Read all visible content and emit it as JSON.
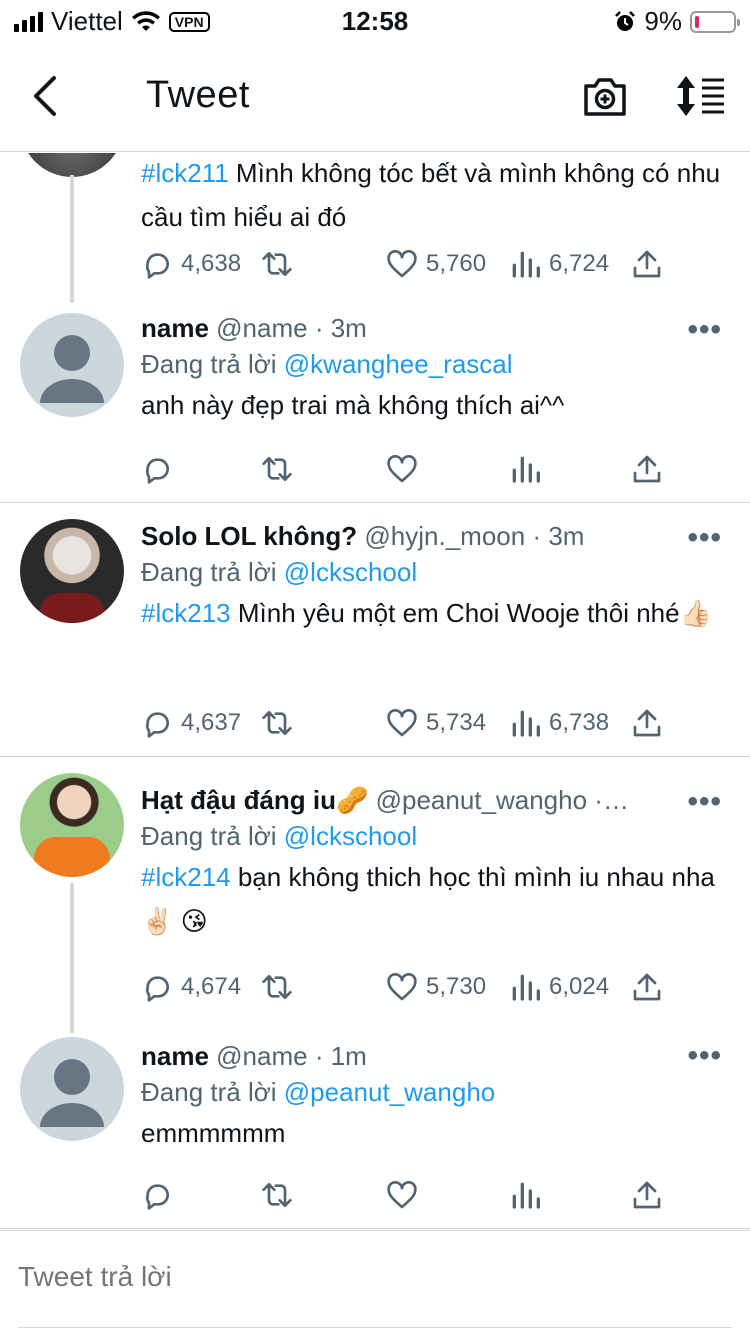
{
  "status_bar": {
    "carrier": "Viettel",
    "vpn": "VPN",
    "time": "12:58",
    "battery": "9%"
  },
  "nav": {
    "title": "Tweet"
  },
  "tweets": [
    {
      "body_tag": "#lck211",
      "body_text": " Mình không tóc bết và mình không có nhu cầu tìm hiểu ai đó",
      "replies": "4,638",
      "likes": "5,760",
      "views": "6,724"
    },
    {
      "name": "name",
      "handle": "@name",
      "time": "· 3m",
      "reply_prefix": "Đang trả lời ",
      "reply_to": "@kwanghee_rascal",
      "body_text": "anh này đẹp trai mà không thích ai^^",
      "more": "•••"
    },
    {
      "name": "Solo LOL không?",
      "handle": "@hyjn._moon",
      "time": "· 3m",
      "reply_prefix": "Đang trả lời ",
      "reply_to": "@lckschool",
      "body_tag": "#lck213",
      "body_text": " Mình yêu một em Choi Wooje thôi nhé👍🏻",
      "replies": "4,637",
      "likes": "5,734",
      "views": "6,738",
      "more": "•••"
    },
    {
      "name": "Hạt đậu đáng iu🥜",
      "handle": "@peanut_wangho",
      "time": "·…",
      "reply_prefix": "Đang trả lời ",
      "reply_to": "@lckschool",
      "body_tag": "#lck214",
      "body_text": " bạn không thich học thì mình iu nhau nha✌🏻 😘",
      "replies": "4,674",
      "likes": "5,730",
      "views": "6,024",
      "more": "•••"
    },
    {
      "name": "name",
      "handle": "@name",
      "time": "· 1m",
      "reply_prefix": "Đang trả lời ",
      "reply_to": "@peanut_wangho",
      "body_text": "emmmmmm",
      "more": "•••"
    }
  ],
  "reply_bar": {
    "placeholder": "Tweet trả lời"
  },
  "colors": {
    "accent": "#1d9bf0",
    "muted": "#536471",
    "border": "#cfd9de"
  },
  "icons": [
    "back-arrow-icon",
    "camera-plus-icon",
    "sort-icon",
    "reply-icon",
    "retweet-icon",
    "like-icon",
    "views-icon",
    "share-icon"
  ]
}
